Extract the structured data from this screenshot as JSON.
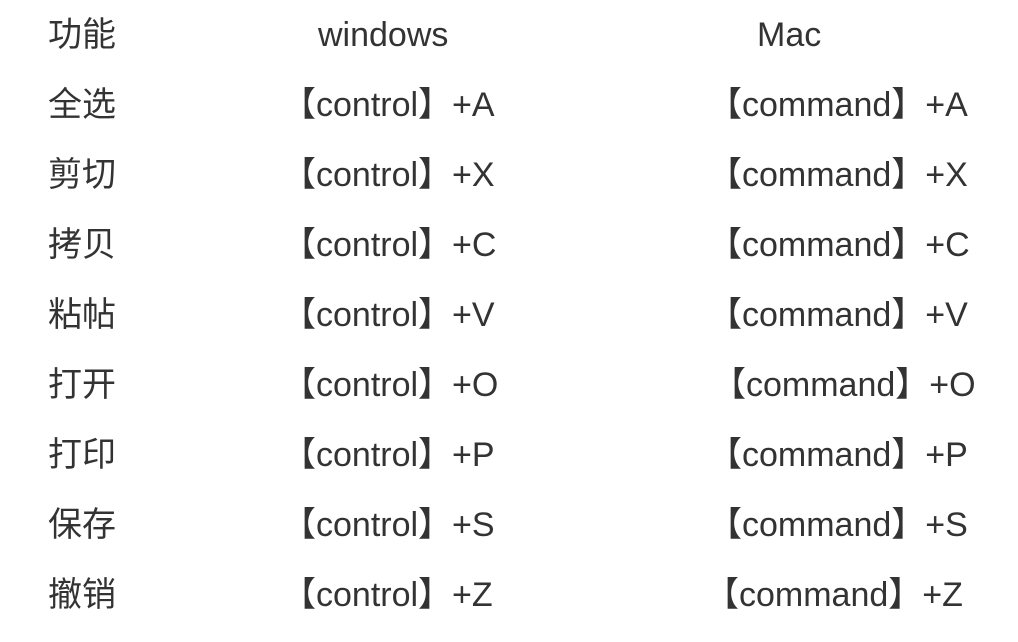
{
  "header": {
    "function": "功能",
    "windows": "windows",
    "mac": "Mac"
  },
  "rows": [
    {
      "function": "全选",
      "windows": "【control】+A",
      "mac": "【command】+A"
    },
    {
      "function": "剪切",
      "windows": "【control】+X",
      "mac": "【command】+X"
    },
    {
      "function": "拷贝",
      "windows": "【control】+C",
      "mac": "【command】+C"
    },
    {
      "function": "粘帖",
      "windows": "【control】+V",
      "mac": "【command】+V"
    },
    {
      "function": "打开",
      "windows": "【control】+O",
      "mac": "【command】+O"
    },
    {
      "function": "打印",
      "windows": "【control】+P",
      "mac": "【command】+P"
    },
    {
      "function": "保存",
      "windows": "【control】+S",
      "mac": "【command】+S"
    },
    {
      "function": "撤销",
      "windows": "【control】+Z",
      "mac": "【command】+Z"
    }
  ]
}
